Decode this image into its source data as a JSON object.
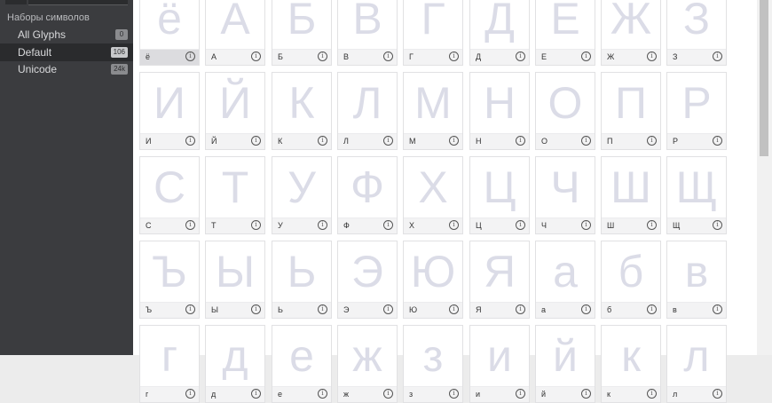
{
  "sidebar": {
    "heading": "Наборы символов",
    "items": [
      {
        "label": "All Glyphs",
        "badge": "0",
        "selected": false
      },
      {
        "label": "Default",
        "badge": "106",
        "selected": true
      },
      {
        "label": "Unicode",
        "badge": "24k",
        "selected": false
      }
    ]
  },
  "grid": {
    "info_icon": "info-circle-icon",
    "rows": [
      [
        {
          "glyph": "ё",
          "name": "ё",
          "selected": true
        },
        {
          "glyph": "А",
          "name": "А"
        },
        {
          "glyph": "Б",
          "name": "Б"
        },
        {
          "glyph": "В",
          "name": "В"
        },
        {
          "glyph": "Г",
          "name": "Г"
        },
        {
          "glyph": "Д",
          "name": "Д"
        },
        {
          "glyph": "Е",
          "name": "Е"
        },
        {
          "glyph": "Ж",
          "name": "Ж"
        },
        {
          "glyph": "З",
          "name": "З"
        }
      ],
      [
        {
          "glyph": "И",
          "name": "И"
        },
        {
          "glyph": "Й",
          "name": "Й"
        },
        {
          "glyph": "К",
          "name": "К"
        },
        {
          "glyph": "Л",
          "name": "Л"
        },
        {
          "glyph": "М",
          "name": "М"
        },
        {
          "glyph": "Н",
          "name": "Н"
        },
        {
          "glyph": "О",
          "name": "О"
        },
        {
          "glyph": "П",
          "name": "П"
        },
        {
          "glyph": "Р",
          "name": "Р"
        }
      ],
      [
        {
          "glyph": "С",
          "name": "С"
        },
        {
          "glyph": "Т",
          "name": "Т"
        },
        {
          "glyph": "У",
          "name": "У"
        },
        {
          "glyph": "Ф",
          "name": "Ф"
        },
        {
          "glyph": "Х",
          "name": "Х"
        },
        {
          "glyph": "Ц",
          "name": "Ц"
        },
        {
          "glyph": "Ч",
          "name": "Ч"
        },
        {
          "glyph": "Ш",
          "name": "Ш"
        },
        {
          "glyph": "Щ",
          "name": "Щ"
        }
      ],
      [
        {
          "glyph": "Ъ",
          "name": "Ъ"
        },
        {
          "glyph": "Ы",
          "name": "Ы"
        },
        {
          "glyph": "Ь",
          "name": "Ь"
        },
        {
          "glyph": "Э",
          "name": "Э"
        },
        {
          "glyph": "Ю",
          "name": "Ю"
        },
        {
          "glyph": "Я",
          "name": "Я"
        },
        {
          "glyph": "а",
          "name": "а"
        },
        {
          "glyph": "б",
          "name": "б"
        },
        {
          "glyph": "в",
          "name": "в"
        }
      ],
      [
        {
          "glyph": "г",
          "name": "г"
        },
        {
          "glyph": "д",
          "name": "д"
        },
        {
          "glyph": "е",
          "name": "е"
        },
        {
          "glyph": "ж",
          "name": "ж"
        },
        {
          "glyph": "з",
          "name": "з"
        },
        {
          "glyph": "и",
          "name": "и"
        },
        {
          "glyph": "й",
          "name": "й"
        },
        {
          "glyph": "к",
          "name": "к"
        },
        {
          "glyph": "л",
          "name": "л"
        }
      ]
    ]
  }
}
